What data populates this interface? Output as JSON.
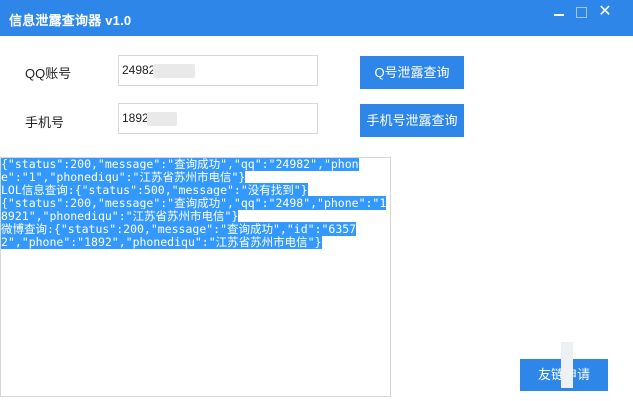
{
  "window": {
    "title": "信息泄露查询器 v1.0",
    "minimize_icon": "minimize-icon",
    "maximize_icon": "maximize-icon",
    "close_glyph": "✕"
  },
  "form": {
    "qq": {
      "label": "QQ账号",
      "value": "24982",
      "button": "Q号泄露查询"
    },
    "phone": {
      "label": "手机号",
      "value": "1892",
      "button": "手机号泄露查询"
    }
  },
  "output": {
    "lines": [
      "{\"status\":200,\"message\":\"查询成功\",\"qq\":\"24982",
      "\",\"phone\":\"1",
      "\",\"phonediqu\":\"江苏省苏州市电信\"}",
      "LOL信息查询:{\"status\":500,\"message\":\"没有找到\"}",
      "{\"status\":200,\"message\":\"查询成功\",\"qq\":\"2498",
      "\",\"phone\":\"18921",
      "\",\"phonediqu\":\"江苏省苏州市电信\"}",
      "微博查询:{\"status\":200,\"message\":\"查询成功\",\"id\":\"63572",
      "\",\"phone\":\"1892",
      "\",\"phonediqu\":\"江苏省苏州市电信\"}"
    ]
  },
  "footer": {
    "apply_button": "友链申请"
  },
  "colors": {
    "accent": "#2d86e8",
    "selection": "#3399ff"
  }
}
